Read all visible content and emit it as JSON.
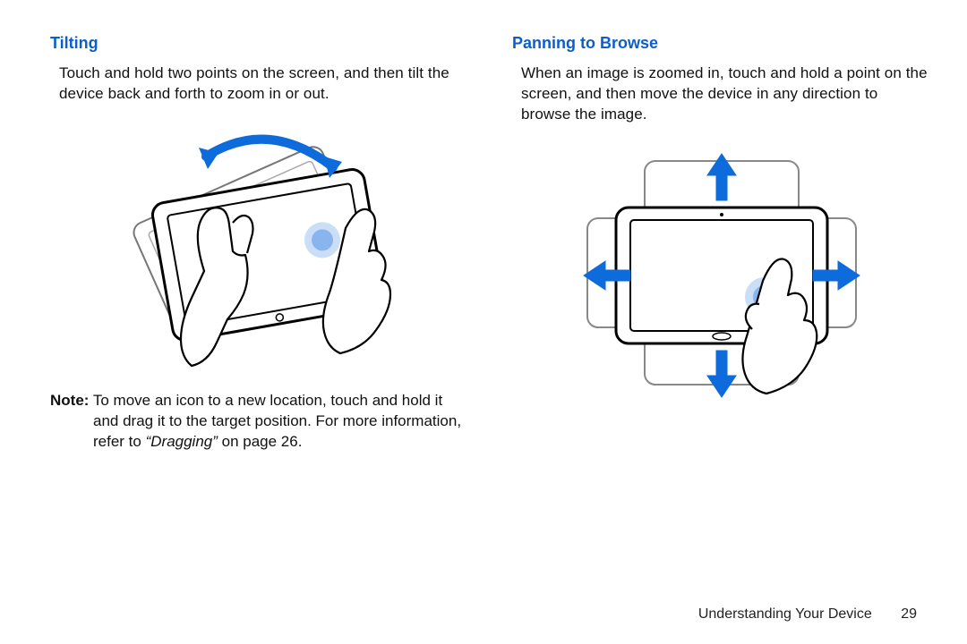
{
  "left": {
    "heading": "Tilting",
    "body": "Touch and hold two points on the screen, and then tilt the device back and forth to zoom in or out.",
    "note_label": "Note:",
    "note_body_1": " To move an icon to a new location, touch and hold it and drag it to the target position. For more information, refer to ",
    "note_crossref": "“Dragging”",
    "note_body_2": " on page 26."
  },
  "right": {
    "heading": "Panning to Browse",
    "body": "When an image is zoomed in, touch and hold a point on the screen, and then move the device in any direction to browse the image."
  },
  "footer": {
    "chapter": "Understanding Your Device",
    "page": "29"
  },
  "colors": {
    "accent_blue": "#0b5ecb",
    "arrow_blue": "#0e6bdc"
  }
}
